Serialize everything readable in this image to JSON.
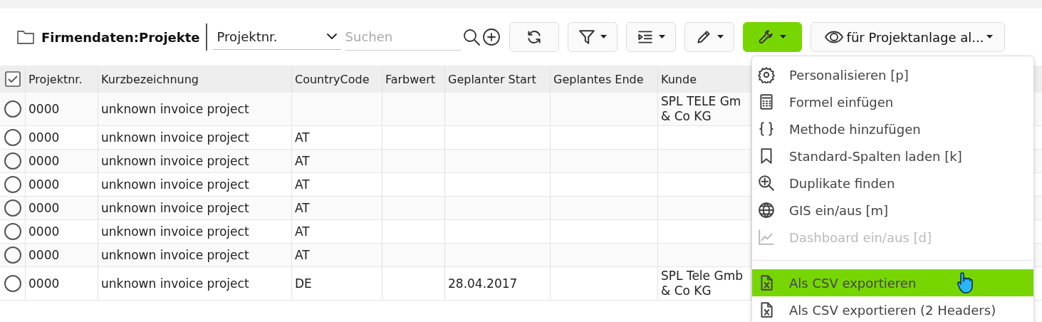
{
  "breadcrumb": {
    "title": "Firmendaten:Projekte"
  },
  "search": {
    "field": "Projektnr.",
    "placeholder": "Suchen"
  },
  "toolbar": {
    "buttons": [
      {
        "kind": "refresh",
        "caret": false,
        "active": false
      },
      {
        "kind": "filter",
        "caret": true,
        "active": false
      },
      {
        "kind": "indent",
        "caret": true,
        "active": false
      },
      {
        "kind": "edit",
        "caret": true,
        "active": false
      },
      {
        "kind": "tools",
        "caret": true,
        "active": true
      }
    ],
    "view": {
      "label": "für Projektanlage al..."
    }
  },
  "table": {
    "select_all_checked": true,
    "columns": [
      "Projektnr.",
      "Kurzbezeichnung",
      "CountryCode",
      "Farbwert",
      "Geplanter Start",
      "Geplantes Ende",
      "Kunde"
    ],
    "rows": [
      {
        "selected": false,
        "cells": [
          "0000",
          "unknown invoice project",
          "",
          "",
          "",
          "",
          "SPL TELE Gm\n& Co KG"
        ]
      },
      {
        "selected": false,
        "cells": [
          "0000",
          "unknown invoice project",
          "AT",
          "",
          "",
          "",
          ""
        ]
      },
      {
        "selected": false,
        "cells": [
          "0000",
          "unknown invoice project",
          "AT",
          "",
          "",
          "",
          ""
        ]
      },
      {
        "selected": false,
        "cells": [
          "0000",
          "unknown invoice project",
          "AT",
          "",
          "",
          "",
          ""
        ]
      },
      {
        "selected": false,
        "cells": [
          "0000",
          "unknown invoice project",
          "AT",
          "",
          "",
          "",
          ""
        ]
      },
      {
        "selected": false,
        "cells": [
          "0000",
          "unknown invoice project",
          "AT",
          "",
          "",
          "",
          ""
        ]
      },
      {
        "selected": false,
        "cells": [
          "0000",
          "unknown invoice project",
          "AT",
          "",
          "",
          "",
          ""
        ]
      },
      {
        "selected": false,
        "cells": [
          "0000",
          "unknown invoice project",
          "DE",
          "",
          "28.04.2017",
          "",
          "SPL Tele Gmb\n& Co KG"
        ]
      }
    ]
  },
  "menu": {
    "sections": [
      {
        "items": [
          {
            "label": "Personalisieren [p]",
            "disabled": false,
            "selected": false
          },
          {
            "label": "Formel einfügen",
            "disabled": false,
            "selected": false
          },
          {
            "label": "Methode hinzufügen",
            "disabled": false,
            "selected": false
          },
          {
            "label": "Standard-Spalten laden [k]",
            "disabled": false,
            "selected": false
          },
          {
            "label": "Duplikate finden",
            "disabled": false,
            "selected": false
          },
          {
            "label": "GIS ein/aus [m]",
            "disabled": false,
            "selected": false
          },
          {
            "label": "Dashboard ein/aus [d]",
            "disabled": true,
            "selected": false
          }
        ]
      },
      {
        "items": [
          {
            "label": "Als CSV exportieren",
            "disabled": false,
            "selected": true
          },
          {
            "label": "Als CSV exportieren (2 Headers)",
            "disabled": false,
            "selected": false
          }
        ]
      }
    ]
  }
}
